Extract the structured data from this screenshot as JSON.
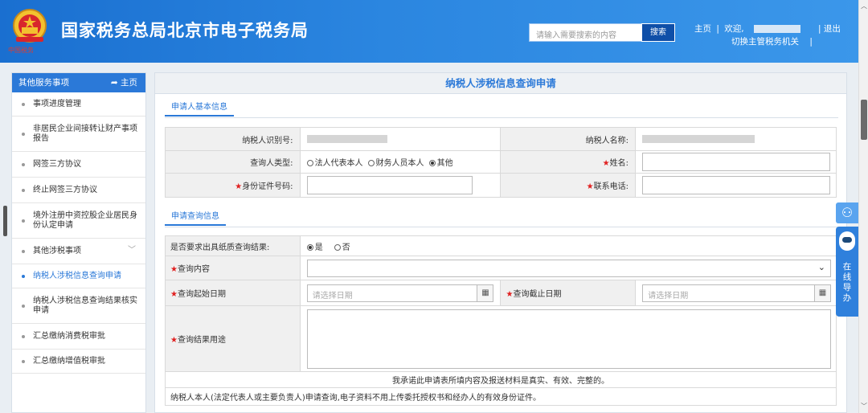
{
  "header": {
    "emblem_label": "中国税务",
    "title": "国家税务总局北京市电子税务局",
    "search_placeholder": "请输入需要搜索的内容",
    "search_button": "搜索",
    "home_link": "主页",
    "welcome": "欢迎,",
    "switch_link": "切换主管税务机关",
    "logout_link": "退出"
  },
  "sidebar": {
    "title": "其他服务事项",
    "home": "主页",
    "items": [
      {
        "label": "事项进度管理"
      },
      {
        "label": "非居民企业间接转让财产事项报告"
      },
      {
        "label": "网签三方协议"
      },
      {
        "label": "终止网签三方协议"
      },
      {
        "label": "境外注册中资控股企业居民身份认定申请"
      },
      {
        "label": "其他涉税事项"
      },
      {
        "label": "纳税人涉税信息查询申请"
      },
      {
        "label": "纳税人涉税信息查询结果核实申请"
      },
      {
        "label": "汇总缴纳消费税审批"
      },
      {
        "label": "汇总缴纳增值税审批"
      }
    ]
  },
  "main": {
    "title": "纳税人涉税信息查询申请",
    "section1": {
      "tab": "申请人基本信息",
      "taxpayer_id_label": "纳税人识别号:",
      "taxpayer_name_label": "纳税人名称:",
      "applicant_type_label": "查询人类型:",
      "applicant_options": [
        "法人代表本人",
        "财务人员本人",
        "其他"
      ],
      "name_label": "姓名:",
      "id_number_label": "身份证件号码:",
      "phone_label": "联系电话:"
    },
    "section2": {
      "tab": "申请查询信息",
      "paper_label": "是否要求出具纸质查询结果:",
      "paper_yes": "是",
      "paper_no": "否",
      "content_label": "查询内容",
      "start_label": "查询起始日期",
      "end_label": "查询截止日期",
      "date_placeholder": "请选择日期",
      "purpose_label": "查询结果用途",
      "pledge": "我承诺此申请表所填内容及报送材料是真实、有效、完整的。",
      "note": "纳税人本人(法定代表人或主要负责人)申请查询,电子资料不用上传委托授权书和经办人的有效身份证件。"
    }
  },
  "float_guide": {
    "label": "在线导办"
  },
  "colors": {
    "header_blue": "#2b86e0",
    "accent": "#2b79d8",
    "required": "#e02020"
  }
}
